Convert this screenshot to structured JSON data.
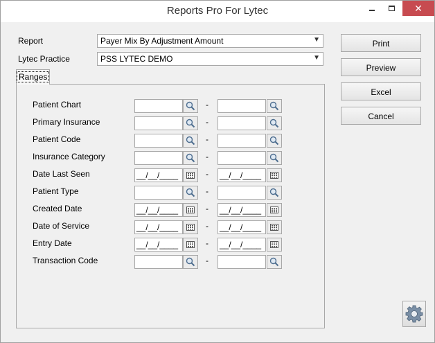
{
  "window": {
    "title": "Reports Pro For Lytec"
  },
  "report": {
    "label": "Report",
    "value": "Payer Mix By Adjustment Amount"
  },
  "practice": {
    "label": "Lytec Practice",
    "value": "PSS LYTEC DEMO"
  },
  "tabs": [
    {
      "label": "Ranges"
    }
  ],
  "ranges": {
    "separator": "-",
    "rows": [
      {
        "label": "Patient Chart",
        "type": "search",
        "from": "",
        "to": ""
      },
      {
        "label": "Primary Insurance",
        "type": "search",
        "from": "",
        "to": ""
      },
      {
        "label": "Patient Code",
        "type": "search",
        "from": "",
        "to": ""
      },
      {
        "label": "Insurance Category",
        "type": "search",
        "from": "",
        "to": ""
      },
      {
        "label": "Date Last Seen",
        "type": "date",
        "from": "__/__/____",
        "to": "__/__/____"
      },
      {
        "label": "Patient Type",
        "type": "search",
        "from": "",
        "to": ""
      },
      {
        "label": "Created Date",
        "type": "date",
        "from": "__/__/____",
        "to": "__/__/____"
      },
      {
        "label": "Date of Service",
        "type": "date",
        "from": "__/__/____",
        "to": "__/__/____"
      },
      {
        "label": "Entry Date",
        "type": "date",
        "from": "__/__/____",
        "to": "__/__/____"
      },
      {
        "label": "Transaction Code",
        "type": "search",
        "from": "",
        "to": ""
      }
    ]
  },
  "buttons": {
    "print": "Print",
    "preview": "Preview",
    "excel": "Excel",
    "cancel": "Cancel"
  },
  "icons": {
    "search": "magnifier-icon",
    "calendar": "calendar-icon",
    "settings": "gear-icon"
  },
  "colors": {
    "close_button": "#c74b50",
    "window_bg": "#f0f0f0"
  }
}
